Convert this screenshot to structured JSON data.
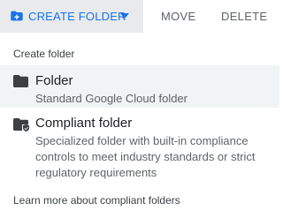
{
  "toolbar": {
    "create_folder_label": "CREATE FOLDER",
    "move_label": "MOVE",
    "delete_label": "DELETE"
  },
  "menu": {
    "heading": "Create folder",
    "items": [
      {
        "title": "Folder",
        "description": "Standard Google Cloud folder",
        "icon": "folder-icon",
        "selected": true
      },
      {
        "title": "Compliant folder",
        "description": "Specialized folder with built-in compliance controls to meet industry standards or strict regulatory requirements",
        "icon": "compliant-folder-icon",
        "selected": false
      }
    ],
    "learn_more": "Learn more about compliant folders"
  },
  "colors": {
    "accent": "#1a73e8",
    "button_bg": "#e8eaed",
    "selected_bg": "#f1f3f4",
    "icon": "#3c4043"
  }
}
